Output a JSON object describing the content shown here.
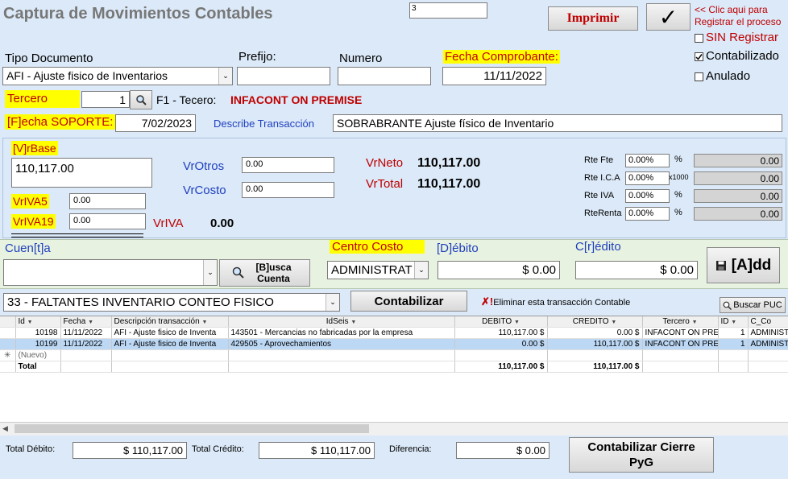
{
  "title": "Captura de Movimientos Contables",
  "counter": "3",
  "print_label": "Imprimir",
  "checkmark": "✓",
  "hint": "<< Clic aqui para Registrar el proceso",
  "options": {
    "sin_registrar": "SIN Registrar",
    "contabilizado": "Contabilizado",
    "anulado": "Anulado",
    "contabilizado_checked": true
  },
  "labels": {
    "tipo_documento": "Tipo Documento",
    "prefijo": "Prefijo:",
    "numero": "Numero",
    "fecha_comprobante": "Fecha Comprobante:",
    "tercero": "Tercero",
    "f1": "F1 - Tecero:",
    "fecha_soporte": "[F]echa SOPORTE:",
    "describe": "Describe Transacción",
    "vrbase": "[V]rBase",
    "vriva5": "VrIVA5",
    "vriva19": "VrIVA19",
    "vriva": "VrIVA",
    "vrotros": "VrOtros",
    "vrcosto": "VrCosto",
    "vrneto": "VrNeto",
    "vrtotal": "VrTotal",
    "rte_fte": "Rte Fte",
    "rte_ica": "Rte I.C.A",
    "rte_iva": "Rte IVA",
    "rte_renta": "RteRenta",
    "pct": "%",
    "x1000": "x1000",
    "cuenta": "Cuen[t]a",
    "centro_costo": "Centro Costo",
    "debito": "[D]ébito",
    "credito": "C[r]édito",
    "busca": "[B]usca Cuenta",
    "add": "[A]dd"
  },
  "values": {
    "tipo_documento": "AFI - Ajuste fisico de Inventarios",
    "prefijo": "",
    "numero": "",
    "fecha_comprobante": "11/11/2022",
    "tercero": "1",
    "tercero_name": "INFACONT ON PREMISE",
    "fecha_soporte": "7/02/2023",
    "describe": "SOBRABRANTE Ajuste físico de Inventario",
    "vrbase": "110,117.00",
    "vriva5": "0.00",
    "vriva19": "0.00",
    "vriva": "0.00",
    "vrotros": "0.00",
    "vrcosto": "0.00",
    "vrneto": "110,117.00",
    "vrtotal": "110,117.00",
    "rte_fte_pct": "0.00%",
    "rte_ica_pct": "0.00%",
    "rte_iva_pct": "0.00%",
    "rte_renta_pct": "0.00%",
    "rte_fte_val": "0.00",
    "rte_ica_val": "0.00",
    "rte_iva_val": "0.00",
    "rte_renta_val": "0.00",
    "centro_costo": "ADMINISTRAT",
    "debito": "$ 0.00",
    "credito": "$ 0.00"
  },
  "account_select": "33 - FALTANTES INVENTARIO CONTEO FISICO",
  "contabilizar_label": "Contabilizar",
  "eliminar_label": "Eliminar esta transacción Contable",
  "buscar_puc_label": "Buscar PUC",
  "grid": {
    "headers": [
      "Id",
      "Fecha",
      "Descripción transacción",
      "IdSeis",
      "DEBITO",
      "CREDITO",
      "Tercero",
      "ID",
      "C_Co"
    ],
    "rows": [
      [
        "10198",
        "11/11/2022",
        "AFI - Ajuste fisico de Inventa",
        "143501 - Mercancias no fabricadas por la empresa",
        "110,117.00 $",
        "0.00 $",
        "INFACONT ON PRE",
        "1",
        "ADMINIST"
      ],
      [
        "10199",
        "11/11/2022",
        "AFI - Ajuste fisico de Inventa",
        "429505 - Aprovechamientos",
        "0.00 $",
        "110,117.00 $",
        "INFACONT ON PRE",
        "1",
        "ADMINIST"
      ]
    ],
    "new_row": "(Nuevo)",
    "total_label": "Total",
    "total_debito": "110,117.00 $",
    "total_credito": "110,117.00 $"
  },
  "footer": {
    "total_debito_label": "Total Débito:",
    "total_debito": "$ 110,117.00",
    "total_credito_label": "Total Crédito:",
    "total_credito": "$ 110,117.00",
    "diferencia_label": "Diferencia:",
    "diferencia": "$ 0.00",
    "cierre_label": "Contabilizar Cierre PyG"
  }
}
